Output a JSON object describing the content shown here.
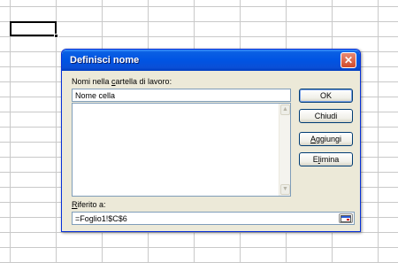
{
  "dialog": {
    "title": "Definisci nome",
    "close_glyph": "✕",
    "names_label_pre": "Nomi nella ",
    "names_label_key": "c",
    "names_label_post": "artella di lavoro:",
    "name_value": "Nome cella",
    "ref_label_key": "R",
    "ref_label_post": "iferito a:",
    "ref_value": "=Foglio1!$C$6",
    "buttons": {
      "ok": "OK",
      "close": "Chiudi",
      "add_key": "A",
      "add_post": "ggiungi",
      "delete_pre": "E",
      "delete_key": "l",
      "delete_post": "imina"
    },
    "scroll_up_glyph": "▲",
    "scroll_down_glyph": "▼",
    "collapse_icon": "collapse-dialog-icon"
  },
  "colors": {
    "titlebar": "#0054e3",
    "dialog_bg": "#ece9d8",
    "grid_line": "#c9c9c9"
  }
}
